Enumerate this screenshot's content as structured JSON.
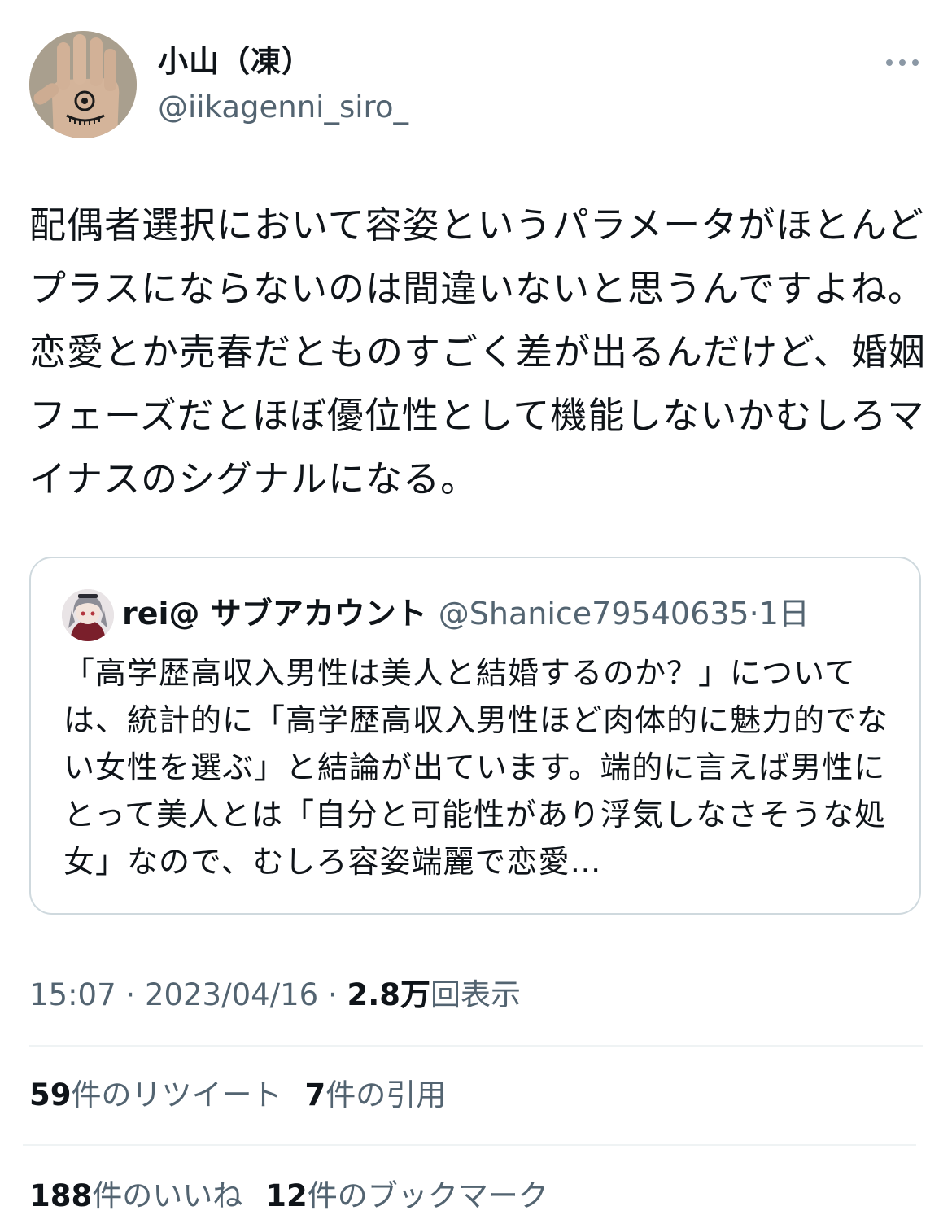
{
  "author": {
    "display_name": "小山（凍）",
    "handle": "@iikagenni_siro_",
    "avatar": "avatar-hand-photo"
  },
  "more_icon": "more-horizontal-icon",
  "tweet": {
    "text": "配偶者選択において容姿というパラメータがほとんどプラスにならないのは間違いないと思うんですよね。恋愛とか売春だとものすごく差が出るんだけど、婚姻フェーズだとほぼ優位性として機能しないかむしろマイナスのシグナルになる。"
  },
  "quote": {
    "display_name": "rei@ サブアカウント",
    "handle": "@Shanice79540635",
    "separator": "·",
    "time": "1日",
    "text": "「高学歴高収入男性は美人と結婚するのか？」については、統計的に「高学歴高収入男性ほど肉体的に魅力的でない女性を選ぶ」と結論が出ています。端的に言えば男性にとって美人とは「自分と可能性があり浮気しなさそうな処女」なので、むしろ容姿端麗で恋愛…"
  },
  "meta": {
    "time": "15:07",
    "separator": "·",
    "date": "2023/04/16",
    "views_number": "2.8万",
    "views_label": "回表示"
  },
  "stats": {
    "retweets_count": "59",
    "retweets_label": "件のリツイート",
    "quotes_count": "7",
    "quotes_label": "件の引用",
    "likes_count": "188",
    "likes_label": "件のいいね",
    "bookmarks_count": "12",
    "bookmarks_label": "件のブックマーク"
  },
  "colors": {
    "text": "#0f1419",
    "secondary": "#536471",
    "border": "#cfd9de",
    "divider": "#eff3f4"
  }
}
